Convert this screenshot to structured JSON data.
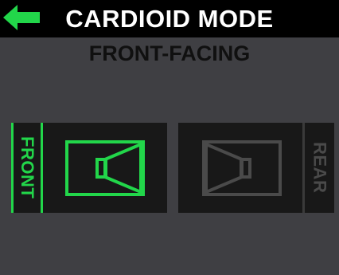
{
  "header": {
    "title": "CARDIOID MODE",
    "back_icon": "arrow-left-icon"
  },
  "subtitle": "FRONT-FACING",
  "panels": {
    "front": {
      "label": "FRONT",
      "state": "active",
      "icon": "speaker-icon"
    },
    "rear": {
      "label": "REAR",
      "state": "inactive",
      "icon": "speaker-icon"
    }
  },
  "colors": {
    "background": "#3f3f43",
    "header": "#000000",
    "active": "#22d64a",
    "inactive": "#4a4a4a",
    "panel": "#181818"
  }
}
